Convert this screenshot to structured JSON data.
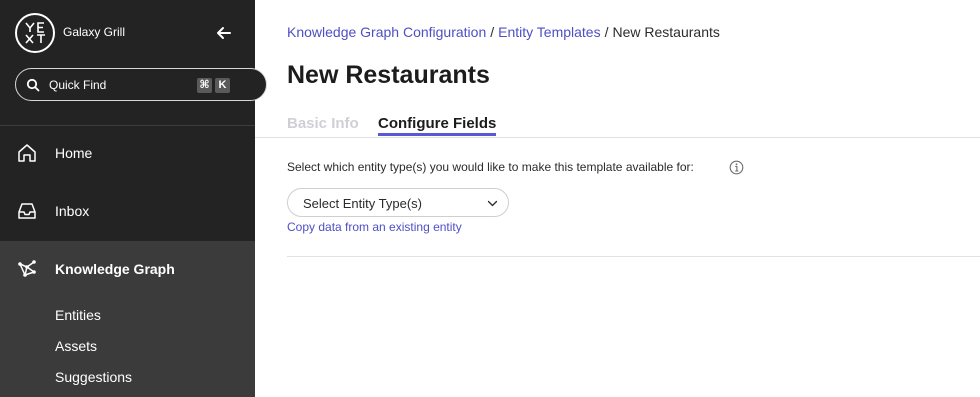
{
  "sidebar": {
    "logo_text": "YEXT",
    "account_name": "Galaxy Grill",
    "quick_find": {
      "label": "Quick Find",
      "shortcut_modifier": "⌘",
      "shortcut_key": "K"
    },
    "nav": {
      "home": "Home",
      "inbox": "Inbox",
      "knowledge_graph": "Knowledge Graph"
    },
    "kg_subitems": [
      "Entities",
      "Assets",
      "Suggestions"
    ]
  },
  "main": {
    "breadcrumb": {
      "crumb1": "Knowledge Graph Configuration",
      "crumb2": "Entity Templates",
      "current": "New Restaurants",
      "separator": "/"
    },
    "title": "New Restaurants",
    "tabs": {
      "basic_info": "Basic Info",
      "configure_fields": "Configure Fields"
    },
    "instruction": "Select which entity type(s) you would like to make this template available for:",
    "select": {
      "label": "Select Entity Type(s)"
    },
    "copy_link": "Copy data from an existing entity"
  },
  "colors": {
    "sidebar_bg": "#232323",
    "sidebar_active_bg": "#3b3b3b",
    "link": "#4e4fc4",
    "tab_underline": "#5a58d6"
  }
}
